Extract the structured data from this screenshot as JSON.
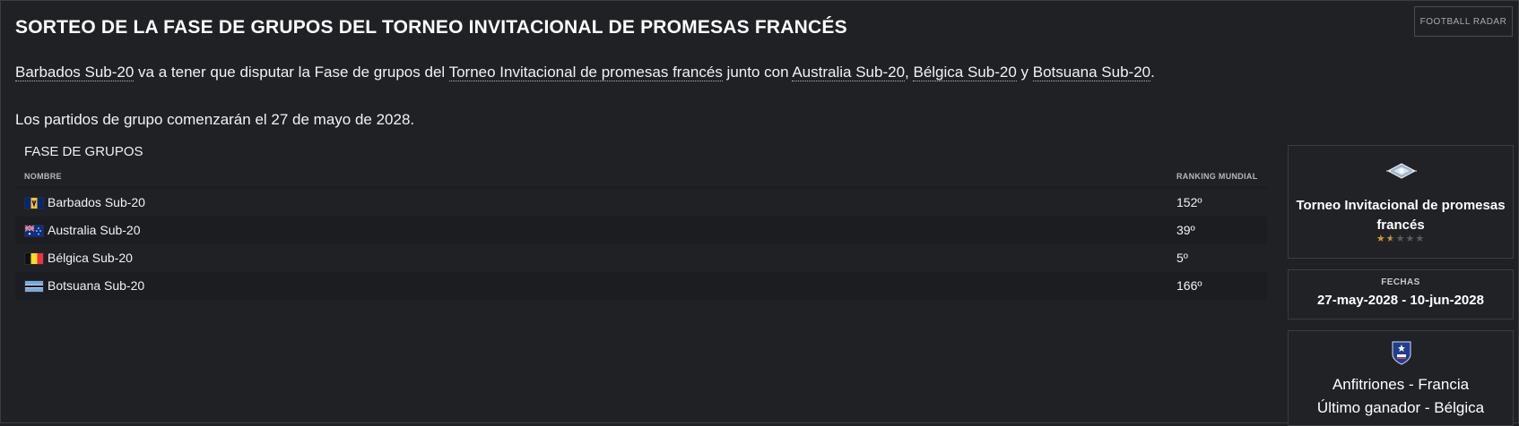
{
  "page": {
    "title": "SORTEO DE LA FASE DE GRUPOS DEL TORNEO INVITACIONAL DE PROMESAS FRANCÉS",
    "radar_button": "FOOTBALL RADAR"
  },
  "intro": {
    "team": "Barbados Sub-20",
    "text1": " va a tener que disputar la ",
    "phase": "Fase de grupos",
    "text2": " del ",
    "competition": "Torneo Invitacional de promesas francés",
    "text3": " junto con ",
    "rival1": "Australia Sub-20",
    "sep1": ", ",
    "rival2": "Bélgica Sub-20",
    "sep2": " y ",
    "rival3": "Botsuana Sub-20",
    "end": "."
  },
  "start_text": "Los partidos de grupo comenzarán el 27 de mayo de 2028.",
  "group": {
    "title": "FASE DE GRUPOS",
    "col_name": "NOMBRE",
    "col_rank": "RANKING MUNDIAL",
    "teams": [
      {
        "name": "Barbados Sub-20",
        "rank": "152º",
        "flag": "barbados-flag-icon"
      },
      {
        "name": "Australia Sub-20",
        "rank": "39º",
        "flag": "australia-flag-icon"
      },
      {
        "name": "Bélgica Sub-20",
        "rank": "5º",
        "flag": "belgium-flag-icon"
      },
      {
        "name": "Botsuana Sub-20",
        "rank": "166º",
        "flag": "botswana-flag-icon"
      }
    ]
  },
  "sidebar": {
    "competition": {
      "logo": "tournament-crest-icon",
      "name": "Torneo Invitacional de promesas francés",
      "reputation_stars": 1.5,
      "reputation_max": 5
    },
    "dates": {
      "label": "FECHAS",
      "value": "27-may-2028 - 10-jun-2028"
    },
    "hosts": {
      "logo": "fff-crest-icon",
      "host": "Anfitriones - Francia",
      "last_winner": "Último ganador - Bélgica"
    }
  },
  "colors": {
    "background": "#1f2125",
    "panel_border": "#3a3c40",
    "star_on": "#d79a2b",
    "star_off": "#5a5c60"
  }
}
